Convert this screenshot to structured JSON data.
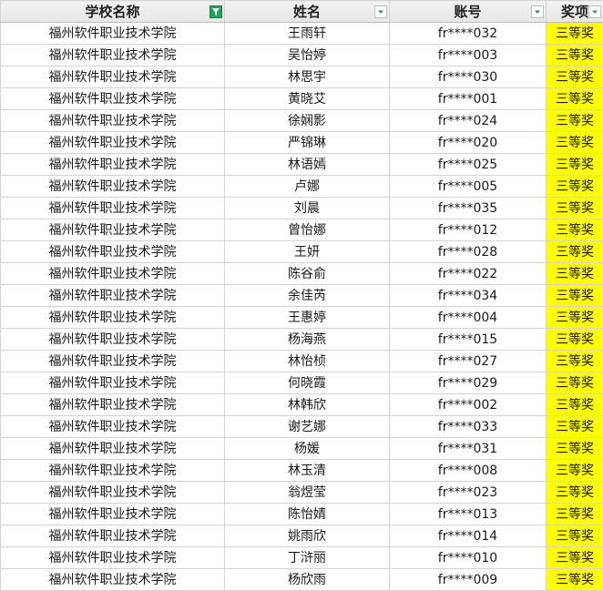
{
  "headers": {
    "school": "学校名称",
    "name": "姓名",
    "account": "账号",
    "award": "奖项"
  },
  "filter_icons": {
    "school": "filter-active-icon",
    "name": "dropdown-arrow-icon",
    "account": "dropdown-arrow-icon",
    "award": "dropdown-arrow-icon"
  },
  "colors": {
    "award_highlight": "#ffff00",
    "active_filter": "#22a35a",
    "dropdown_arrow": "#3a9a4a"
  },
  "rows": [
    {
      "school": "福州软件职业技术学院",
      "name": "王雨轩",
      "account": "fr****032",
      "award": "三等奖"
    },
    {
      "school": "福州软件职业技术学院",
      "name": "吴怡婷",
      "account": "fr****003",
      "award": "三等奖"
    },
    {
      "school": "福州软件职业技术学院",
      "name": "林思宇",
      "account": "fr****030",
      "award": "三等奖"
    },
    {
      "school": "福州软件职业技术学院",
      "name": "黄晓艾",
      "account": "fr****001",
      "award": "三等奖"
    },
    {
      "school": "福州软件职业技术学院",
      "name": "徐娴影",
      "account": "fr****024",
      "award": "三等奖"
    },
    {
      "school": "福州软件职业技术学院",
      "name": "严锦琳",
      "account": "fr****020",
      "award": "三等奖"
    },
    {
      "school": "福州软件职业技术学院",
      "name": "林语嫣",
      "account": "fr****025",
      "award": "三等奖"
    },
    {
      "school": "福州软件职业技术学院",
      "name": "卢娜",
      "account": "fr****005",
      "award": "三等奖"
    },
    {
      "school": "福州软件职业技术学院",
      "name": "刘晨",
      "account": "fr****035",
      "award": "三等奖"
    },
    {
      "school": "福州软件职业技术学院",
      "name": "曾怡娜",
      "account": "fr****012",
      "award": "三等奖"
    },
    {
      "school": "福州软件职业技术学院",
      "name": "王妍",
      "account": "fr****028",
      "award": "三等奖"
    },
    {
      "school": "福州软件职业技术学院",
      "name": "陈谷俞",
      "account": "fr****022",
      "award": "三等奖"
    },
    {
      "school": "福州软件职业技术学院",
      "name": "余佳芮",
      "account": "fr****034",
      "award": "三等奖"
    },
    {
      "school": "福州软件职业技术学院",
      "name": "王惠婷",
      "account": "fr****004",
      "award": "三等奖"
    },
    {
      "school": "福州软件职业技术学院",
      "name": "杨海燕",
      "account": "fr****015",
      "award": "三等奖"
    },
    {
      "school": "福州软件职业技术学院",
      "name": "林怡桢",
      "account": "fr****027",
      "award": "三等奖"
    },
    {
      "school": "福州软件职业技术学院",
      "name": "何晓霞",
      "account": "fr****029",
      "award": "三等奖"
    },
    {
      "school": "福州软件职业技术学院",
      "name": "林韩欣",
      "account": "fr****002",
      "award": "三等奖"
    },
    {
      "school": "福州软件职业技术学院",
      "name": "谢艺娜",
      "account": "fr****033",
      "award": "三等奖"
    },
    {
      "school": "福州软件职业技术学院",
      "name": "杨媛",
      "account": "fr****031",
      "award": "三等奖"
    },
    {
      "school": "福州软件职业技术学院",
      "name": "林玉清",
      "account": "fr****008",
      "award": "三等奖"
    },
    {
      "school": "福州软件职业技术学院",
      "name": "翁煜莹",
      "account": "fr****023",
      "award": "三等奖"
    },
    {
      "school": "福州软件职业技术学院",
      "name": "陈怡婧",
      "account": "fr****013",
      "award": "三等奖"
    },
    {
      "school": "福州软件职业技术学院",
      "name": "姚雨欣",
      "account": "fr****014",
      "award": "三等奖"
    },
    {
      "school": "福州软件职业技术学院",
      "name": "丁浒丽",
      "account": "fr****010",
      "award": "三等奖"
    },
    {
      "school": "福州软件职业技术学院",
      "name": "杨欣雨",
      "account": "fr****009",
      "award": "三等奖"
    }
  ]
}
